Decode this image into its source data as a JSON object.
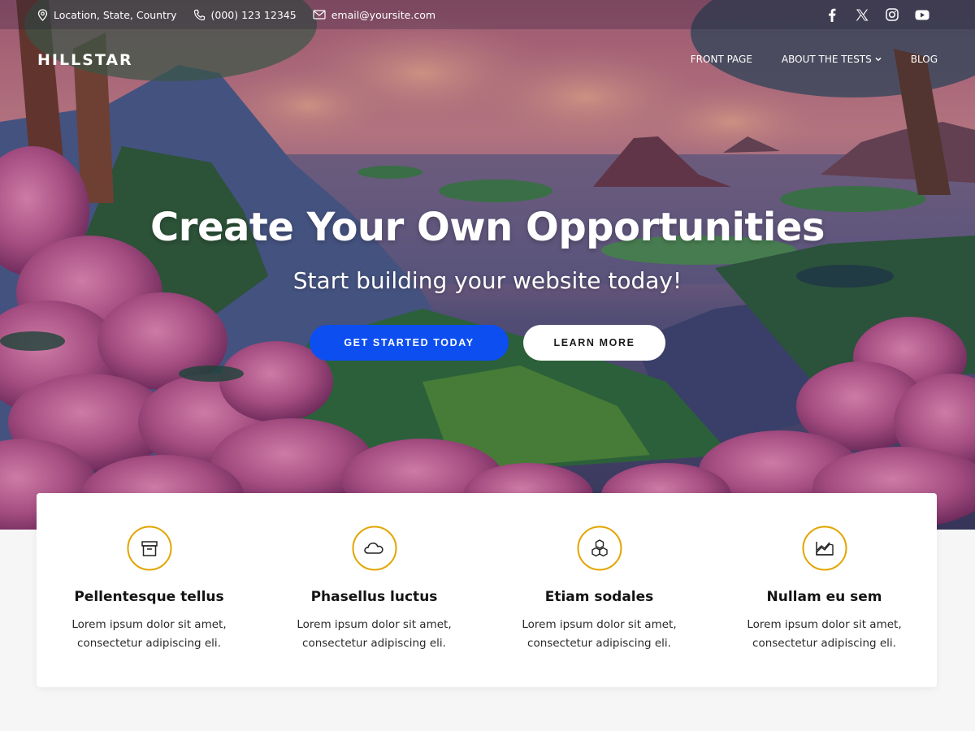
{
  "topbar": {
    "location": "Location, State, Country",
    "phone": "(000) 123 12345",
    "email": "email@yoursite.com",
    "social": [
      {
        "icon": "facebook-icon"
      },
      {
        "icon": "x-icon"
      },
      {
        "icon": "instagram-icon"
      },
      {
        "icon": "youtube-icon"
      }
    ]
  },
  "header": {
    "logo": "HILLSTAR",
    "nav": [
      {
        "label": "FRONT PAGE"
      },
      {
        "label": "ABOUT THE TESTS",
        "has_dropdown": true
      },
      {
        "label": "BLOG"
      }
    ]
  },
  "hero": {
    "title": "Create Your Own Opportunities",
    "subtitle": "Start building your website today!",
    "primary_button": "GET STARTED TODAY",
    "secondary_button": "LEARN MORE"
  },
  "features": [
    {
      "icon": "archive-box-icon",
      "title": "Pellentesque tellus",
      "desc_line1": "Lorem ipsum dolor sit amet,",
      "desc_line2": "consectetur adipiscing eli."
    },
    {
      "icon": "cloud-icon",
      "title": "Phasellus luctus",
      "desc_line1": "Lorem ipsum dolor sit amet,",
      "desc_line2": "consectetur adipiscing eli."
    },
    {
      "icon": "cubes-icon",
      "title": "Etiam sodales",
      "desc_line1": "Lorem ipsum dolor sit amet,",
      "desc_line2": "consectetur adipiscing eli."
    },
    {
      "icon": "chart-icon",
      "title": "Nullam eu sem",
      "desc_line1": "Lorem ipsum dolor sit amet,",
      "desc_line2": "consectetur adipiscing eli."
    }
  ],
  "colors": {
    "primary_button": "#0d4ef0",
    "icon_ring": "#e2a600",
    "page_background": "#f6f6f7"
  }
}
